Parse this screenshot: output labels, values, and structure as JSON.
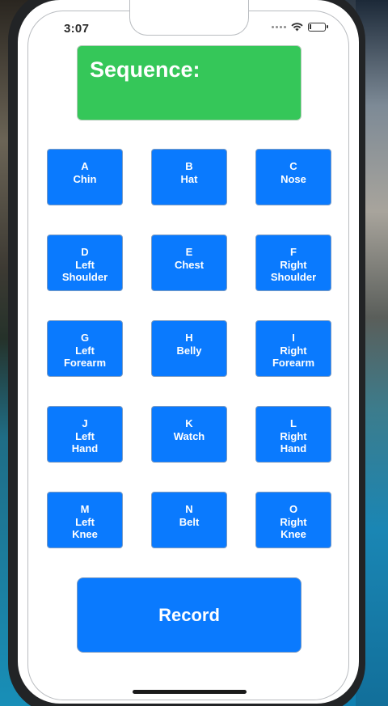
{
  "status_bar": {
    "time": "3:07"
  },
  "sequence": {
    "label": "Sequence:"
  },
  "buttons": [
    {
      "letter": "A",
      "line1": "Chin",
      "line2": ""
    },
    {
      "letter": "B",
      "line1": "Hat",
      "line2": ""
    },
    {
      "letter": "C",
      "line1": "Nose",
      "line2": ""
    },
    {
      "letter": "D",
      "line1": "Left",
      "line2": "Shoulder"
    },
    {
      "letter": "E",
      "line1": "Chest",
      "line2": ""
    },
    {
      "letter": "F",
      "line1": "Right",
      "line2": "Shoulder"
    },
    {
      "letter": "G",
      "line1": "Left",
      "line2": "Forearm"
    },
    {
      "letter": "H",
      "line1": "Belly",
      "line2": ""
    },
    {
      "letter": "I",
      "line1": "Right",
      "line2": "Forearm"
    },
    {
      "letter": "J",
      "line1": "Left",
      "line2": "Hand"
    },
    {
      "letter": "K",
      "line1": "Watch",
      "line2": ""
    },
    {
      "letter": "L",
      "line1": "Right",
      "line2": "Hand"
    },
    {
      "letter": "M",
      "line1": "Left",
      "line2": "Knee"
    },
    {
      "letter": "N",
      "line1": "Belt",
      "line2": ""
    },
    {
      "letter": "O",
      "line1": "Right",
      "line2": "Knee"
    }
  ],
  "record": {
    "label": "Record"
  },
  "colors": {
    "sequence_bg": "#35c759",
    "button_bg": "#0a7afe",
    "text": "#ffffff"
  },
  "icons": [
    "signal-dots-icon",
    "wifi-icon",
    "battery-icon"
  ]
}
